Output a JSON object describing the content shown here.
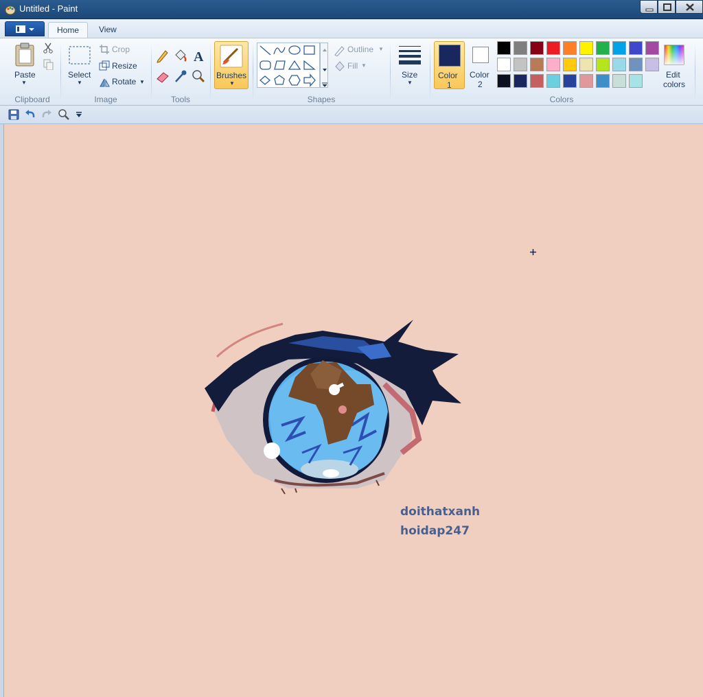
{
  "window": {
    "title": "Untitled - Paint"
  },
  "tabs": {
    "home": "Home",
    "view": "View"
  },
  "ribbon": {
    "clipboard": {
      "paste": "Paste",
      "label": "Clipboard"
    },
    "image": {
      "select": "Select",
      "crop": "Crop",
      "resize": "Resize",
      "rotate": "Rotate",
      "label": "Image"
    },
    "tools": {
      "label": "Tools"
    },
    "brushes": {
      "label": "Brushes"
    },
    "shapes": {
      "outline": "Outline",
      "fill": "Fill",
      "label": "Shapes"
    },
    "size": {
      "label": "Size"
    },
    "color1": {
      "line1": "Color",
      "line2": "1",
      "value": "#18285e"
    },
    "color2": {
      "line1": "Color",
      "line2": "2",
      "value": "#ffffff"
    },
    "colors": {
      "label": "Colors",
      "edit_line1": "Edit",
      "edit_line2": "colors",
      "palette": [
        [
          "#000000",
          "#7f7f7f",
          "#880015",
          "#ed1c24",
          "#ff7f27",
          "#fff200",
          "#22b14c",
          "#00a2e8",
          "#3f48cc",
          "#a349a4"
        ],
        [
          "#ffffff",
          "#c3c3c3",
          "#b97a57",
          "#ffaec9",
          "#ffc90e",
          "#efe4b0",
          "#b5e61d",
          "#99d9ea",
          "#7092be",
          "#c8bfe7"
        ],
        [
          "#0b1020",
          "#18285e",
          "#c4605f",
          "#6ccfe0",
          "#28419a",
          "#e0989a",
          "#3d8fc9",
          "#c6dfd8",
          "#a7e3e6",
          null
        ]
      ]
    }
  },
  "canvas": {
    "background": "#f0cfc1",
    "watermark_line1": "doithatxanh",
    "watermark_line2": "hoidap247"
  }
}
